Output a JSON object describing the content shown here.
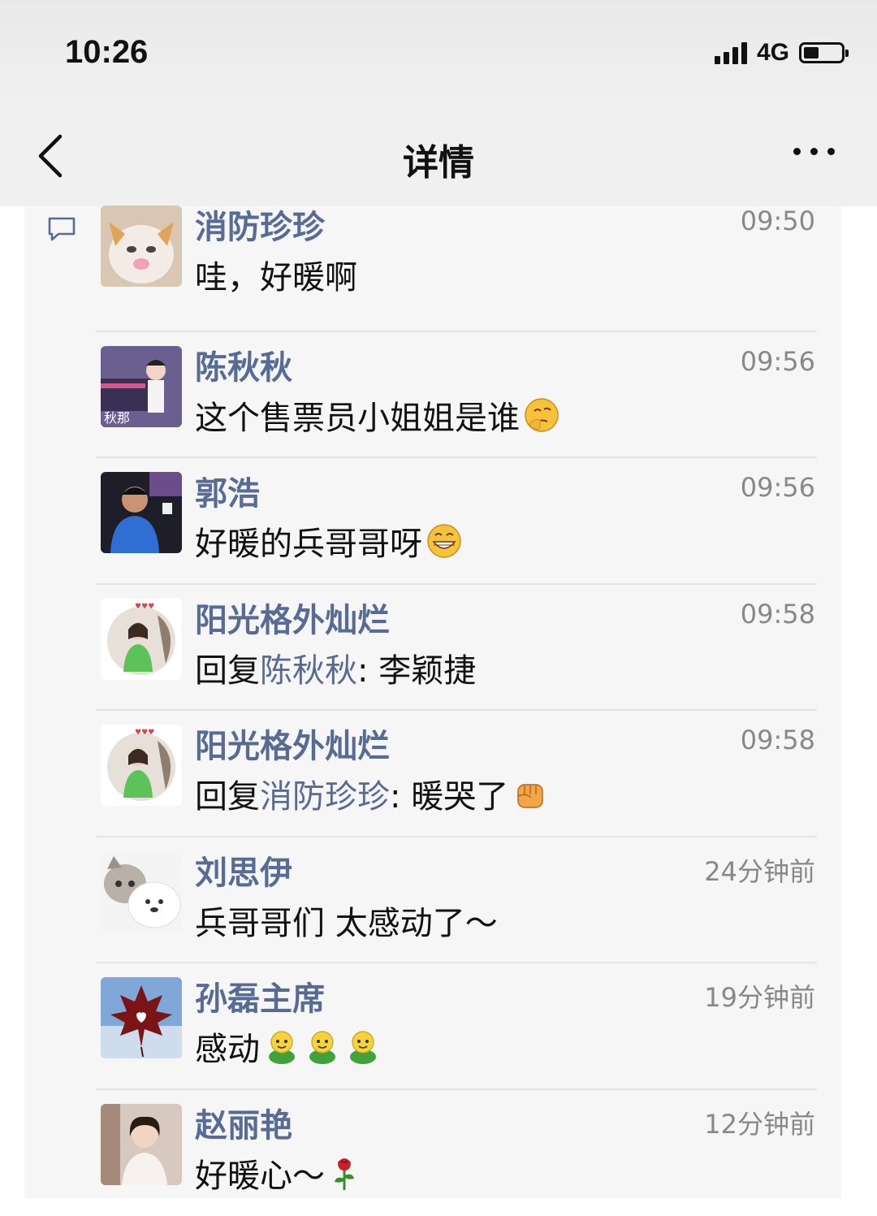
{
  "status_bar": {
    "time": "10:26",
    "network": "4G",
    "battery_level": 0.4
  },
  "nav": {
    "title": "详情"
  },
  "colors": {
    "name": "#576b95",
    "time": "#888888",
    "panel": "#f6f6f6"
  },
  "comments": [
    {
      "name": "消防珍珍",
      "time": "09:50",
      "text": "哇，好暖啊",
      "avatar": "kitten-avatar"
    },
    {
      "name": "陈秋秋",
      "time": "09:56",
      "text": "这个售票员小姐姐是谁",
      "emoji": [
        "thinking-emoji"
      ],
      "avatar": "train-avatar"
    },
    {
      "name": "郭浩",
      "time": "09:56",
      "text": "好暖的兵哥哥呀",
      "emoji": [
        "grin-emoji"
      ],
      "avatar": "man-avatar"
    },
    {
      "name": "阳光格外灿烂",
      "time": "09:58",
      "reply_prefix": "回复",
      "reply_to": "陈秋秋",
      "text": ": 李颖捷",
      "avatar": "girl-avatar"
    },
    {
      "name": "阳光格外灿烂",
      "time": "09:58",
      "reply_prefix": "回复",
      "reply_to": "消防珍珍",
      "text": ": 暖哭了",
      "emoji": [
        "fist-emoji"
      ],
      "avatar": "girl-avatar"
    },
    {
      "name": "刘思伊",
      "time": "24分钟前",
      "text": "兵哥哥们 太感动了～",
      "avatar": "cat-bear-avatar"
    },
    {
      "name": "孙磊主席",
      "time": "19分钟前",
      "text": "感动",
      "emoji": [
        "sprout-emoji",
        "sprout-emoji",
        "sprout-emoji"
      ],
      "avatar": "maple-avatar"
    },
    {
      "name": "赵丽艳",
      "time": "12分钟前",
      "text": "好暖心～",
      "emoji": [
        "rose-emoji"
      ],
      "avatar": "woman-avatar"
    }
  ]
}
